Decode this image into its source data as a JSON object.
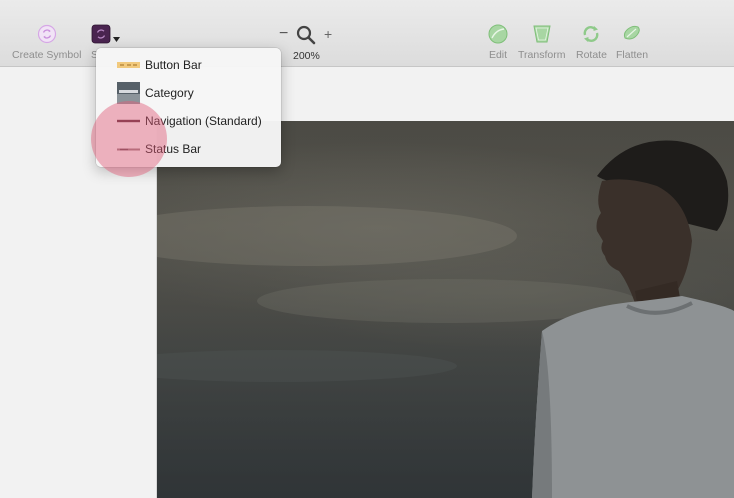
{
  "toolbar": {
    "create_symbol_label": "Create Symbol",
    "symbol_label_partial": "S",
    "zoom_out_glyph": "−",
    "zoom_in_glyph": "+",
    "zoom_level": "200%",
    "edit_label": "Edit",
    "transform_label": "Transform",
    "rotate_label": "Rotate",
    "flatten_label": "Flatten"
  },
  "symbols_menu": {
    "items": [
      {
        "label": "Button Bar",
        "thumb": "button-bar-thumb"
      },
      {
        "label": "Category",
        "thumb": "category-thumb"
      },
      {
        "label": "Navigation (Standard)",
        "thumb": "navigation-thumb"
      },
      {
        "label": "Status Bar",
        "thumb": "status-bar-thumb"
      }
    ]
  },
  "colors": {
    "toolbar_icon_accent": "#8fca8a",
    "symbol_icon": "#5a2d5e",
    "create_symbol_icon": "#d6a7e6",
    "click_highlight": "#e15a78"
  }
}
